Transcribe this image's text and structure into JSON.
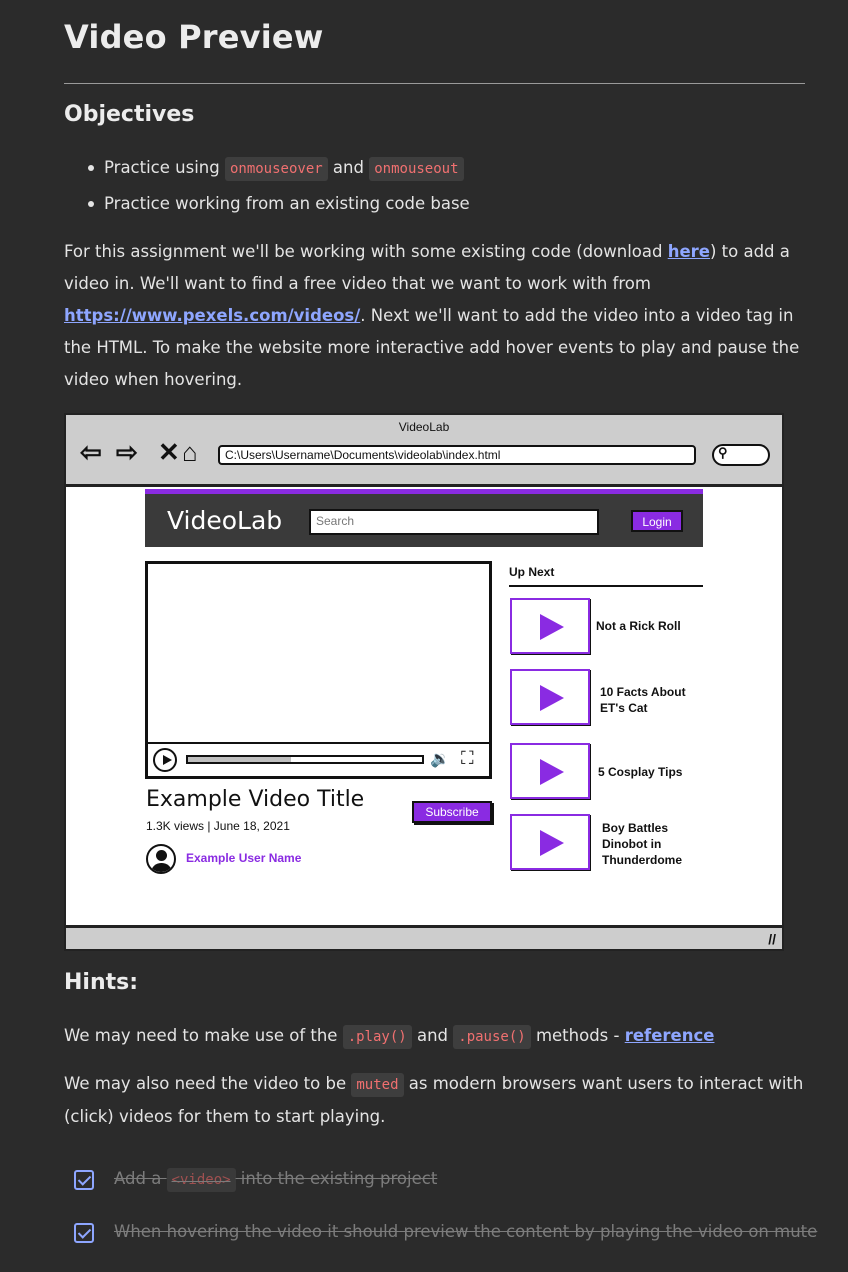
{
  "page": {
    "title": "Video Preview",
    "objectives_heading": "Objectives",
    "objectives": [
      {
        "prefix": "Practice using ",
        "code1": "onmouseover",
        "mid": " and ",
        "code2": "onmouseout"
      },
      {
        "text": "Practice working from an existing code base"
      }
    ],
    "intro": {
      "part1": "For this assignment we'll be working with some existing code (download ",
      "link_here": "here",
      "part2": ") to add a video in. We'll want to find a free video that we want to work with from ",
      "link_pexels": "https://www.pexels.com/videos/",
      "part3": ".  Next we'll want to add the video into a video tag in the HTML. To make the website more interactive add hover events to play and pause the video when hovering."
    },
    "hints_heading": "Hints:",
    "hint1": {
      "prefix": "We may need to make use of the ",
      "code1": ".play()",
      "mid": " and ",
      "code2": ".pause()",
      "suffix": " methods - ",
      "link": "reference"
    },
    "hint2": {
      "prefix": "We may also need the video to be ",
      "code": "muted",
      "suffix": " as modern browsers want users to interact with (click) videos for them to start playing."
    },
    "checklist": [
      {
        "prefix": "Add a ",
        "code": "<video>",
        "suffix": " into the existing project",
        "checked": true
      },
      {
        "text": "When hovering the video it should preview the content by playing the video on mute",
        "checked": true
      }
    ]
  },
  "mockup": {
    "window_title": "VideoLab",
    "url": "C:\\Users\\Username\\Documents\\videolab\\index.html",
    "site_logo": "VideoLab",
    "search_placeholder": "Search",
    "login_label": "Login",
    "video_title": "Example Video Title",
    "video_meta": "1.3K views  |  June 18, 2021",
    "subscribe_label": "Subscribe",
    "user_name": "Example User Name",
    "up_next_label": "Up Next",
    "progress_fraction": 0.44,
    "up_next": [
      {
        "title": "Not a Rick Roll"
      },
      {
        "title": "10 Facts About ET's Cat"
      },
      {
        "title": "5 Cosplay Tips"
      },
      {
        "title": "Boy Battles Dinobot in Thunderdome"
      }
    ],
    "accent_color": "#8a2be2"
  }
}
